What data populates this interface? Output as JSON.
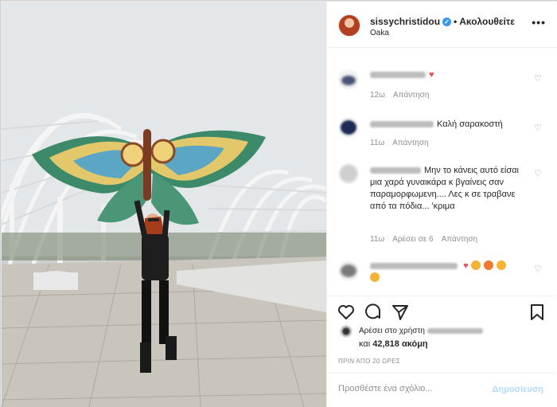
{
  "post": {
    "username": "sissychristidou",
    "separator": "•",
    "follow_status": "Ακολουθείτε",
    "location": "Oaka",
    "more_icon": "more-dots-icon",
    "verified_icon": "verified-badge-icon"
  },
  "comments": [
    {
      "text": "",
      "time": "12ω",
      "reply_label": "Απάντηση",
      "likes_label": ""
    },
    {
      "text": "Καλή σαρακοστή",
      "time": "11ω",
      "reply_label": "Απάντηση",
      "likes_label": ""
    },
    {
      "text": "Μην το κάνεις αυτό είσαι μια χαρά γυναικάρα κ βγαίνεις σαν παραμορφωμενη.... Λες κ σε τραβανε από τα πόδια... 'κριμα",
      "time": "11ω",
      "reply_label": "Απάντηση",
      "likes_label": "Αρέσει σε 6"
    },
    {
      "text": "",
      "time": "",
      "reply_label": "",
      "likes_label": ""
    }
  ],
  "actions": {
    "like_icon": "heart-icon",
    "comment_icon": "comment-icon",
    "share_icon": "share-icon",
    "save_icon": "bookmark-icon"
  },
  "likes": {
    "liked_by_prefix": "Αρέσει στο χρήστη",
    "and_label": "και",
    "count": "42,818",
    "more_label": "ακόμη"
  },
  "timestamp": "ΠΡΙΝ ΑΠΟ 20 ΩΡΕΣ",
  "comment_box": {
    "placeholder": "Προσθέστε ένα σχόλιο...",
    "post_label": "Δημοσίευση"
  },
  "colors": {
    "accent_blue": "#3897f0",
    "post_disabled": "#b3dbff",
    "heart_red": "#ed4956"
  }
}
